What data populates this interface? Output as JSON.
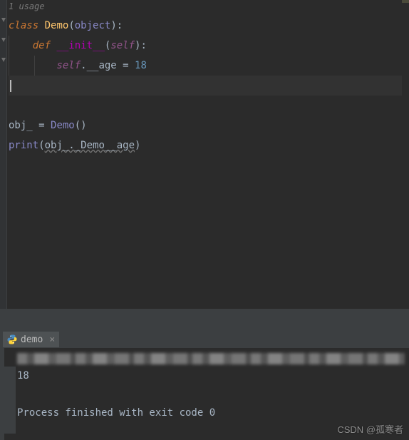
{
  "editor": {
    "usage_hint": "1 usage",
    "lines": {
      "l1": {
        "kw": "class",
        "name": "Demo",
        "base": "object"
      },
      "l2": {
        "kw": "def",
        "fn": "__init__",
        "self": "self"
      },
      "l3": {
        "self": "self",
        "attr": ".__age = ",
        "num": "18"
      },
      "l5": {
        "var": "obj_ = ",
        "cls": "Demo",
        "tail": "()"
      },
      "l6": {
        "fn": "print",
        "open": "(",
        "arg": "obj_._Demo__age",
        "close": ")"
      }
    }
  },
  "run_tab": {
    "label": "demo",
    "close_glyph": "×",
    "icon_name": "python-icon"
  },
  "console": {
    "output_value": "18",
    "exit_line": "Process finished with exit code 0"
  },
  "watermark": "CSDN @孤寒者"
}
